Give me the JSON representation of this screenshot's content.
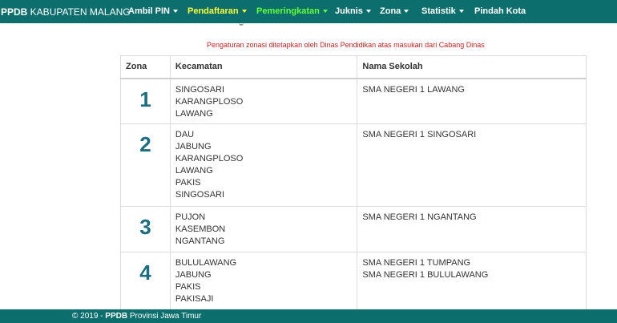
{
  "navbar": {
    "brand_bold": "PPDB",
    "brand_rest": " KABUPATEN MALANG",
    "items": [
      {
        "label": "Ambil PIN"
      },
      {
        "label": "Pendaftaran"
      },
      {
        "label": "Pemeringkatan"
      },
      {
        "label": "Juknis"
      },
      {
        "label": "Zona"
      },
      {
        "label": "Statistik"
      },
      {
        "label": "Pindah Kota"
      }
    ]
  },
  "notice": "Pengaturan zonasi ditetapkan oleh Dinas Pendidikan atas masukan dari Cabang Dinas",
  "table": {
    "headers": [
      "Zona",
      "Kecamatan",
      "Nama Sekolah"
    ],
    "rows": [
      {
        "zona": "1",
        "kecamatan": [
          "SINGOSARI",
          "KARANGPLOSO",
          "LAWANG"
        ],
        "sekolah": [
          "SMA NEGERI 1 LAWANG"
        ]
      },
      {
        "zona": "2",
        "kecamatan": [
          "DAU",
          "JABUNG",
          "KARANGPLOSO",
          "LAWANG",
          "PAKIS",
          "SINGOSARI"
        ],
        "sekolah": [
          "SMA NEGERI 1 SINGOSARI"
        ]
      },
      {
        "zona": "3",
        "kecamatan": [
          "PUJON",
          "KASEMBON",
          "NGANTANG"
        ],
        "sekolah": [
          "SMA NEGERI 1 NGANTANG"
        ]
      },
      {
        "zona": "4",
        "kecamatan": [
          "BULULAWANG",
          "JABUNG",
          "PAKIS",
          "PAKISAJI"
        ],
        "sekolah": [
          "SMA NEGERI 1 TUMPANG",
          "SMA NEGERI 1 BULULAWANG"
        ]
      }
    ]
  },
  "footer": {
    "prefix": "© 2019 - ",
    "bold": "PPDB",
    "suffix": " Provinsi Jawa Timur"
  }
}
